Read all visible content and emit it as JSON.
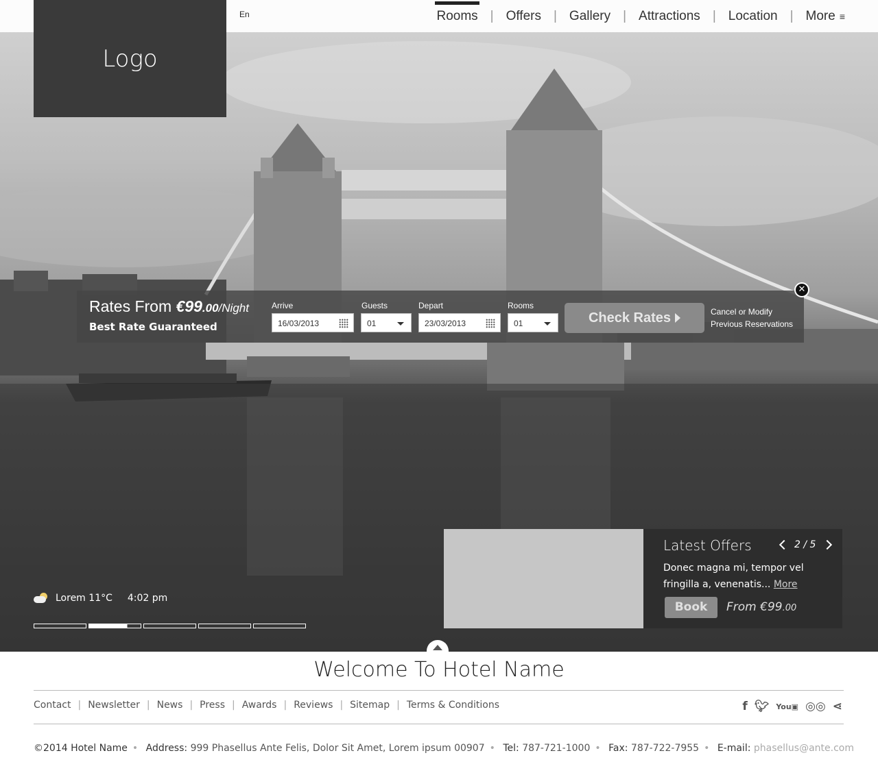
{
  "header": {
    "logo": "Logo",
    "language": "En",
    "nav": [
      "Rooms",
      "Offers",
      "Gallery",
      "Attractions",
      "Location",
      "More"
    ],
    "active_nav": "Rooms"
  },
  "booking": {
    "rates_from_label": "Rates From",
    "price": "€99",
    "price_cents": ".00",
    "per_night": "/Night",
    "best_rate": "Best Rate Guaranteed",
    "arrive_label": "Arrive",
    "arrive_value": "16/03/2013",
    "guests_label": "Guests",
    "guests_value": "01",
    "depart_label": "Depart",
    "depart_value": "23/03/2013",
    "rooms_label": "Rooms",
    "rooms_value": "01",
    "check_rates": "Check Rates",
    "cancel_line1": "Cancel or Modify",
    "cancel_line2": "Previous Reservations"
  },
  "weather": {
    "location": "Lorem",
    "temp": "11°C",
    "time": "4:02 pm"
  },
  "slider": {
    "count": 5,
    "active_index": 1
  },
  "offers": {
    "title": "Latest Offers",
    "pager": "2 / 5",
    "text": "Donec magna mi, tempor vel fringilla a, venenatis...",
    "more": "More",
    "book": "Book",
    "from": "From €99",
    "from_cents": ".00"
  },
  "footer": {
    "welcome": "Welcome To Hotel Name",
    "links": [
      "Contact",
      "Newsletter",
      "News",
      "Press",
      "Awards",
      "Reviews",
      "Sitemap",
      "Terms & Conditions"
    ],
    "socials": [
      "facebook-icon",
      "twitter-icon",
      "youtube-icon",
      "tripadvisor-icon",
      "share-icon"
    ],
    "copyright": "©2014 Hotel Name",
    "address_label": "Address:",
    "address": "999 Phasellus Ante Felis, Dolor Sit Amet, Lorem ipsum 00907",
    "tel_label": "Tel:",
    "tel": "787-721-1000",
    "fax_label": "Fax:",
    "fax": "787-722-7955",
    "email_label": "E-mail:",
    "email": "phasellus@ante.com"
  }
}
